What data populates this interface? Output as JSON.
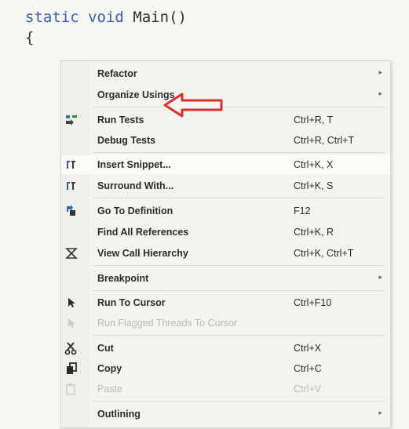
{
  "code": {
    "line1_kw1": "static",
    "line1_kw2": "void",
    "line1_rest": "Main()",
    "line2": "{"
  },
  "menu": {
    "refactor": {
      "label": "Refactor"
    },
    "organize_usings": {
      "label": "Organize Usings"
    },
    "run_tests": {
      "label": "Run Tests",
      "shortcut": "Ctrl+R, T",
      "icon": "run-tests-icon"
    },
    "debug_tests": {
      "label": "Debug Tests",
      "shortcut": "Ctrl+R, Ctrl+T"
    },
    "insert_snippet": {
      "label": "Insert Snippet...",
      "shortcut": "Ctrl+K, X",
      "icon": "snippet-icon"
    },
    "surround_with": {
      "label": "Surround With...",
      "shortcut": "Ctrl+K, S",
      "icon": "snippet-icon"
    },
    "go_to_definition": {
      "label": "Go To Definition",
      "shortcut": "F12",
      "icon": "go-to-definition-icon"
    },
    "find_all_references": {
      "label": "Find All References",
      "shortcut": "Ctrl+K, R"
    },
    "view_call_hierarchy": {
      "label": "View Call Hierarchy",
      "shortcut": "Ctrl+K, Ctrl+T",
      "icon": "call-hierarchy-icon"
    },
    "breakpoint": {
      "label": "Breakpoint"
    },
    "run_to_cursor": {
      "label": "Run To Cursor",
      "shortcut": "Ctrl+F10",
      "icon": "run-to-cursor-icon"
    },
    "run_flagged_threads": {
      "label": "Run Flagged Threads To Cursor",
      "icon": "flagged-threads-icon"
    },
    "cut": {
      "label": "Cut",
      "shortcut": "Ctrl+X",
      "icon": "cut-icon"
    },
    "copy": {
      "label": "Copy",
      "shortcut": "Ctrl+C",
      "icon": "copy-icon"
    },
    "paste": {
      "label": "Paste",
      "shortcut": "Ctrl+V",
      "icon": "paste-icon"
    },
    "outlining": {
      "label": "Outlining"
    },
    "submenu_glyph": "▸"
  },
  "annotation": {
    "arrow_color": "#d9302a"
  }
}
